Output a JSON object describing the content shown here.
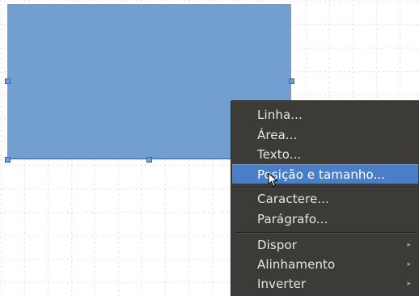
{
  "context_menu": {
    "items": [
      {
        "label": "Linha..."
      },
      {
        "label": "Área..."
      },
      {
        "label": "Texto..."
      },
      {
        "label": "Posição e tamanho..."
      },
      {
        "label": "Caractere..."
      },
      {
        "label": "Parágrafo..."
      },
      {
        "label": "Dispor"
      },
      {
        "label": "Alinhamento"
      },
      {
        "label": "Inverter"
      }
    ],
    "highlighted": "Posição e tamanho..."
  },
  "colors": {
    "shape_fill": "#729fcf",
    "menu_background": "#3c3b37",
    "menu_highlight": "#4a7fc8"
  }
}
